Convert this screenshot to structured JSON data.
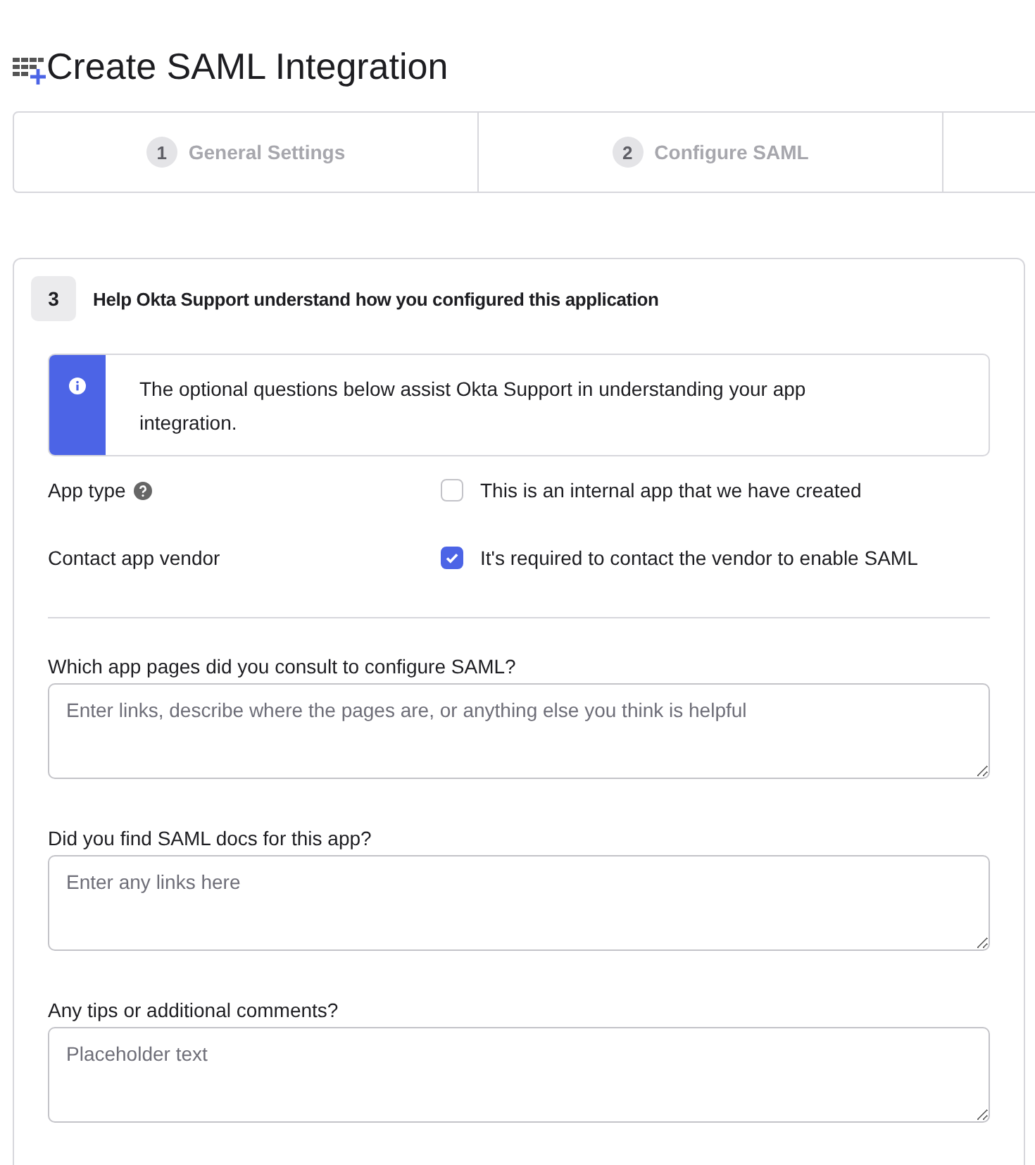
{
  "page_title": "Create SAML Integration",
  "steps": [
    {
      "number": "1",
      "label": "General Settings",
      "selected": false
    },
    {
      "number": "2",
      "label": "Configure SAML",
      "selected": false
    }
  ],
  "section": {
    "number": "3",
    "title": "Help Okta Support understand how you configured this application"
  },
  "callout": {
    "text": "The optional questions below assist Okta Support in understanding your app integration."
  },
  "options": [
    {
      "label": "App type",
      "help": true,
      "choice": "This is an internal app that we have created",
      "checked": false
    },
    {
      "label": "Contact app vendor",
      "help": false,
      "choice": "It's required to contact the vendor to enable SAML",
      "checked": true
    }
  ],
  "questions": [
    {
      "label": "Which app pages did you consult to configure SAML?",
      "placeholder": "Enter links, describe where the pages are, or anything else you think is helpful"
    },
    {
      "label": "Did you find SAML docs for this app?",
      "placeholder": "Enter any links here"
    },
    {
      "label": "Any tips or additional comments?",
      "placeholder": "Placeholder text"
    }
  ]
}
